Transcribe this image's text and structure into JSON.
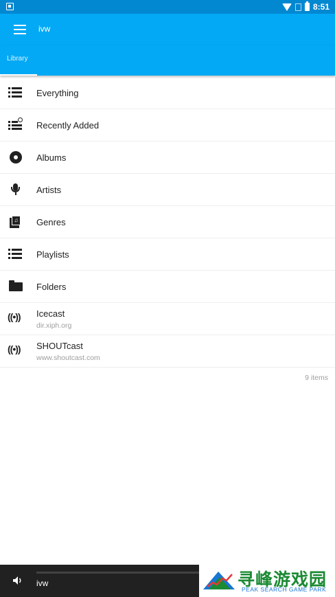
{
  "status_bar": {
    "time": "8:51",
    "icons": [
      "notification-icon",
      "wifi-icon",
      "no-signal-icon",
      "battery-icon"
    ]
  },
  "app_bar": {
    "title": "ivw",
    "menu_icon": "hamburger-menu-icon"
  },
  "tabs": [
    {
      "label": "Library",
      "selected": true
    }
  ],
  "list": {
    "items": [
      {
        "label": "Everything",
        "icon": "list-icon"
      },
      {
        "label": "Recently Added",
        "icon": "recent-list-icon"
      },
      {
        "label": "Albums",
        "icon": "album-disc-icon"
      },
      {
        "label": "Artists",
        "icon": "microphone-icon"
      },
      {
        "label": "Genres",
        "icon": "genre-music-icon"
      },
      {
        "label": "Playlists",
        "icon": "playlist-icon"
      },
      {
        "label": "Folders",
        "icon": "folder-icon"
      },
      {
        "label": "Icecast",
        "sub": "dir.xiph.org",
        "icon": "radio-broadcast-icon"
      },
      {
        "label": "SHOUTcast",
        "sub": "www.shoutcast.com",
        "icon": "radio-broadcast-icon"
      }
    ],
    "count_text": "9 items"
  },
  "player": {
    "title": "ivw",
    "volume_icon": "volume-icon"
  },
  "watermark": {
    "title": "寻峰游戏园",
    "subtitle": "PEAK SEARCH GAME PARK"
  },
  "colors": {
    "status_bar": "#0288d1",
    "app_bar": "#03a9f4",
    "player_bg": "#212121",
    "watermark_green": "#1b8a33",
    "watermark_blue": "#1976d2"
  }
}
